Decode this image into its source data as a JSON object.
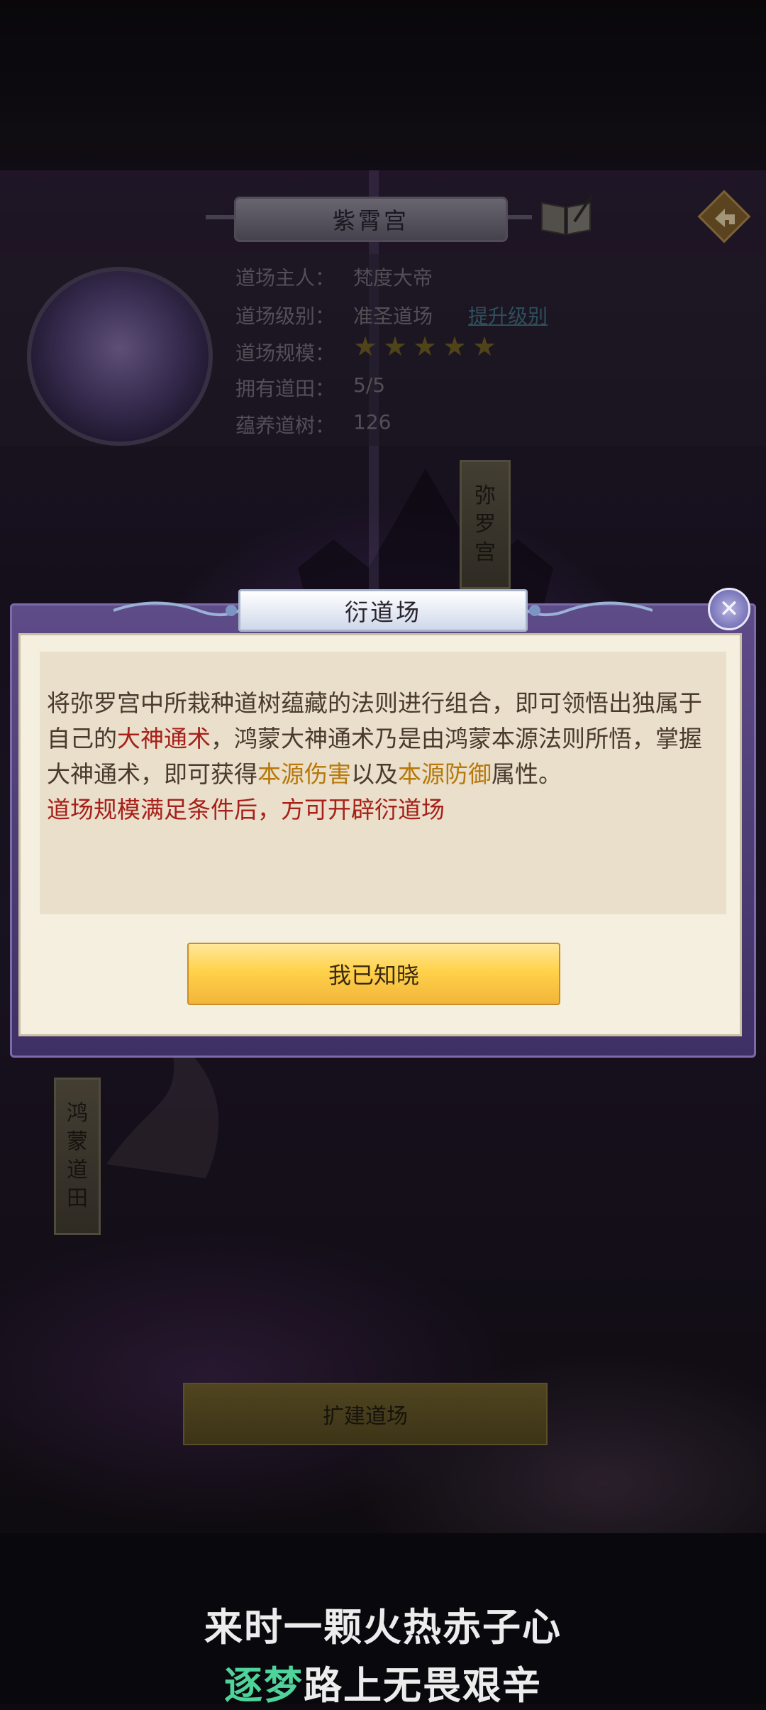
{
  "header": {
    "title": "紫霄宫",
    "book_icon": "book-quill-icon",
    "back_icon": "back-arrow-icon"
  },
  "info": {
    "rows": [
      {
        "label": "道场主人：",
        "value": "梵度大帝"
      },
      {
        "label": "道场级别：",
        "value": "准圣道场"
      },
      {
        "label": "道场规模：",
        "value": ""
      },
      {
        "label": "拥有道田：",
        "value": "5/5"
      },
      {
        "label": "蕴养道树：",
        "value": "126"
      }
    ],
    "upgrade_link": "提升级别",
    "stars": 5
  },
  "banners": {
    "miluo": [
      "弥",
      "罗",
      "宫"
    ],
    "hongmeng": [
      "鸿",
      "蒙",
      "道",
      "田"
    ]
  },
  "expand_button": "扩建道场",
  "modal": {
    "title": "衍道场",
    "text_1": "将弥罗宫中所栽种道树蕴藏的法则进行组合，即可领悟出独属于自己的",
    "highlight_1": "大神通术",
    "text_2": "，鸿蒙大神通术乃是由鸿蒙本源法则所悟，掌握大神通术，即可获得",
    "highlight_2": "本源伤害",
    "text_3": "以及",
    "highlight_3": "本源防御",
    "text_4": "属性。",
    "red_line": "道场规模满足条件后，方可开辟衍道场",
    "confirm_button": "我已知晓",
    "close_icon": "close-x-icon"
  },
  "subtitles": {
    "line1": "来时一颗火热赤子心",
    "line2_green": "逐梦",
    "line2_rest": "路上无畏艰辛"
  },
  "colors": {
    "highlight_red": "#a7201a",
    "highlight_gold": "#b8780a",
    "subtitle_green": "#4fd39a",
    "confirm_gold": "#ffd24a"
  }
}
